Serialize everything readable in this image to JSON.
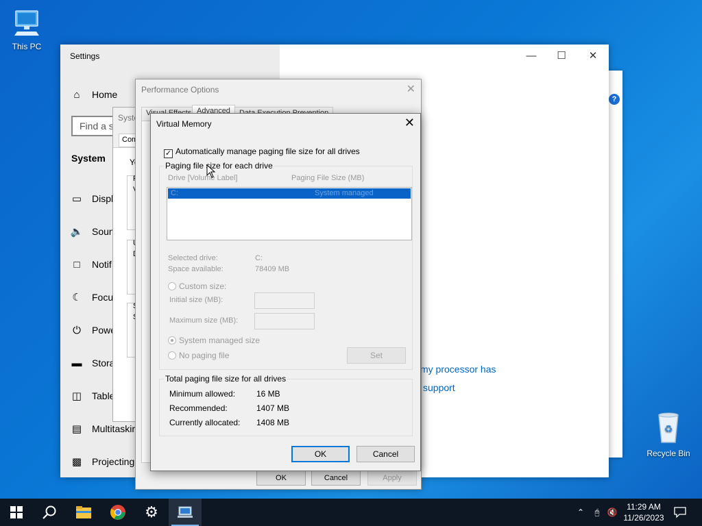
{
  "desktop": {
    "this_pc_label": "This PC",
    "recycle_bin_label": "Recycle Bin"
  },
  "settings": {
    "title": "Settings",
    "search_placeholder": "Find a s",
    "home_label": "Home",
    "section_label": "System",
    "nav_items": [
      {
        "label": "Displ",
        "icon": "monitor-icon"
      },
      {
        "label": "Soun",
        "icon": "speaker-icon"
      },
      {
        "label": "Notif",
        "icon": "notification-icon"
      },
      {
        "label": "Focu",
        "icon": "moon-icon"
      },
      {
        "label": "Powe",
        "icon": "power-icon"
      },
      {
        "label": "Stora",
        "icon": "storage-icon"
      },
      {
        "label": "Table",
        "icon": "tablet-icon"
      },
      {
        "label": "Multitaskir",
        "icon": "multitasking-icon"
      },
      {
        "label": "Projecting",
        "icon": "projecting-icon"
      }
    ],
    "links": {
      "processor": "my processor has",
      "support": "support"
    }
  },
  "system_properties": {
    "title": "Syste",
    "tab": "Com",
    "text_fragments": [
      "Yo",
      "P",
      "V",
      "U",
      "D",
      "S",
      "S"
    ]
  },
  "performance_options": {
    "title": "Performance Options",
    "tabs": [
      "Visual Effects",
      "Advanced",
      "Data Execution Prevention"
    ],
    "ok_label": "OK",
    "cancel_label": "Cancel",
    "apply_label": "Apply"
  },
  "virtual_memory": {
    "title": "Virtual Memory",
    "auto_manage_label": "Automatically manage paging file size for all drives",
    "auto_manage_checked": true,
    "paging_group_label": "Paging file size for each drive",
    "col_drive": "Drive  [Volume Label]",
    "col_size": "Paging File Size (MB)",
    "drive_rows": [
      {
        "drive": "C:",
        "size": "System managed"
      }
    ],
    "selected_drive_label": "Selected drive:",
    "selected_drive_value": "C:",
    "space_available_label": "Space available:",
    "space_available_value": "78409 MB",
    "custom_size_label": "Custom size:",
    "initial_size_label": "Initial size (MB):",
    "maximum_size_label": "Maximum size (MB):",
    "system_managed_label": "System managed size",
    "no_paging_label": "No paging file",
    "set_label": "Set",
    "total_group_label": "Total paging file size for all drives",
    "minimum_allowed_label": "Minimum allowed:",
    "minimum_allowed_value": "16 MB",
    "recommended_label": "Recommended:",
    "recommended_value": "1407 MB",
    "currently_allocated_label": "Currently allocated:",
    "currently_allocated_value": "1408 MB",
    "ok_label": "OK",
    "cancel_label": "Cancel"
  },
  "taskbar": {
    "time": "11:29 AM",
    "date": "11/26/2023",
    "items": [
      "start-icon",
      "search-icon",
      "file-explorer-icon",
      "chrome-icon",
      "settings-gear-icon",
      "system-properties-icon"
    ]
  },
  "colors": {
    "accent": "#0078d7",
    "selection": "#0a64c8",
    "taskbar": "#0d1724",
    "link": "#0067c0"
  }
}
